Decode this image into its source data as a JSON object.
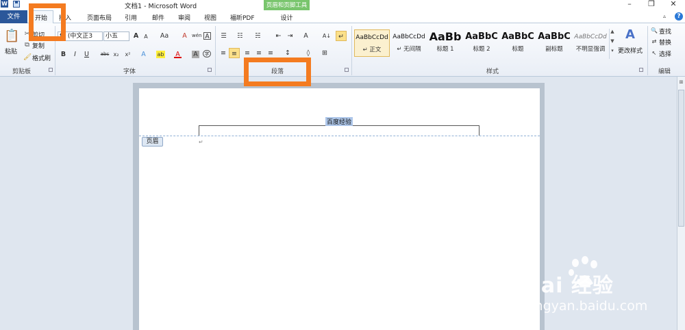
{
  "window": {
    "title": "文档1 - Microsoft Word",
    "app_icon": "W",
    "contextual_group": "页眉和页脚工具",
    "controls": {
      "minimize": "–",
      "restore": "❐",
      "close": "✕"
    }
  },
  "tabs": {
    "file": "文件",
    "home": "开始",
    "insert": "插入",
    "layout": "页面布局",
    "references": "引用",
    "mailings": "邮件",
    "review": "审阅",
    "view": "视图",
    "foxit": "福昕PDF",
    "design": "设计"
  },
  "ribbon": {
    "clipboard": {
      "label": "剪贴板",
      "paste": "粘贴",
      "cut": "剪切",
      "copy": "复制",
      "format_painter": "格式刷"
    },
    "font": {
      "label": "字体",
      "font_name": "体 (中文正3",
      "font_size": "小五",
      "grow": "A",
      "shrink": "A",
      "case": "Aa",
      "clear": "A",
      "phonetic": "wén",
      "border": "A",
      "bold": "B",
      "italic": "I",
      "underline": "U",
      "strike": "abc",
      "subscript": "x₂",
      "superscript": "x²",
      "effects": "A",
      "highlight": "ab",
      "font_color": "A",
      "shade": "A",
      "enclose": "字"
    },
    "paragraph": {
      "label": "段落",
      "bullets": "☰",
      "numbering": "☷",
      "multilevel": "☵",
      "decrease_indent": "⇤",
      "increase_indent": "⇥",
      "chinese_layout": "A",
      "sort": "A↓",
      "show_marks": "↵",
      "align_left": "≡",
      "center": "≡",
      "align_right": "≡",
      "justify": "≡",
      "distributed": "≡",
      "line_spacing": "↕",
      "shading": "◊",
      "borders": "⊞"
    },
    "styles": {
      "label": "样式",
      "items": [
        {
          "sample": "AaBbCcDd",
          "name": "↵ 正文"
        },
        {
          "sample": "AaBbCcDd",
          "name": "↵ 无间隔"
        },
        {
          "sample": "AaBb",
          "name": "标题 1"
        },
        {
          "sample": "AaBbC",
          "name": "标题 2"
        },
        {
          "sample": "AaBbC",
          "name": "标题"
        },
        {
          "sample": "AaBbC",
          "name": "副标题"
        },
        {
          "sample": "AaBbCcDd",
          "name": "不明显强调"
        }
      ],
      "change_styles": "更改样式"
    },
    "editing": {
      "label": "编辑",
      "find": "查找",
      "replace": "替换",
      "select": "选择"
    }
  },
  "document": {
    "header_text": "百度经验",
    "header_tag": "页眉",
    "para_mark": "↵"
  },
  "watermark": {
    "logo": "Bai  经验",
    "url": "jingyan.baidu.com"
  },
  "colors": {
    "file_tab": "#2b579a",
    "contextual": "#79c56d",
    "highlight_box": "#f47b20",
    "selection": "#aec7ea"
  }
}
